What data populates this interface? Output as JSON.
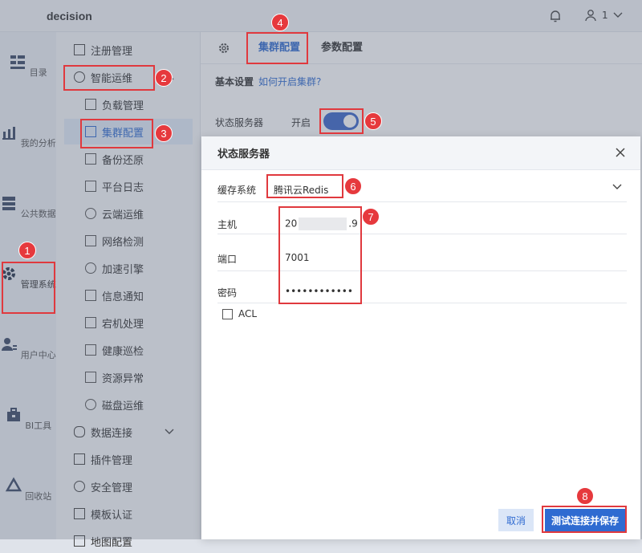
{
  "app": {
    "title": "decision",
    "user_label": "1"
  },
  "leftnav": [
    {
      "label": "目录",
      "icon": "catalog-icon"
    },
    {
      "label": "我的分析",
      "icon": "analysis-icon"
    },
    {
      "label": "公共数据",
      "icon": "database-icon"
    },
    {
      "label": "管理系统",
      "icon": "system-gear-icon"
    },
    {
      "label": "用户中心",
      "icon": "user-center-icon"
    },
    {
      "label": "BI工具",
      "icon": "toolbox-icon"
    },
    {
      "label": "回收站",
      "icon": "recycle-icon"
    }
  ],
  "submenu": {
    "register": "注册管理",
    "smart_ops": "智能运维",
    "children": [
      "负载管理",
      "集群配置",
      "备份还原",
      "平台日志",
      "云端运维",
      "网络检测",
      "加速引擎",
      "信息通知",
      "宕机处理",
      "健康巡检",
      "资源异常",
      "磁盘运维"
    ],
    "data_conn": "数据连接",
    "plugin": "插件管理",
    "security": "安全管理",
    "template": "模板认证",
    "map": "地图配置"
  },
  "main": {
    "tabs": [
      "集群配置",
      "参数配置"
    ],
    "basic": "基本设置",
    "howto_link": "如何开启集群?",
    "server_label": "状态服务器",
    "server_state": "开启"
  },
  "dialog": {
    "title": "状态服务器",
    "cache_label": "缓存系统",
    "cache_value": "腾讯云Redis",
    "host_label": "主机",
    "host_prefix": "20",
    "host_suffix": ".9",
    "port_label": "端口",
    "port_value": "7001",
    "password_label": "密码",
    "password_value": "••••••••••••",
    "acl_label": "ACL",
    "cancel": "取消",
    "save": "测试连接并保存"
  },
  "badges": [
    "1",
    "2",
    "3",
    "4",
    "5",
    "6",
    "7",
    "8"
  ],
  "colors": {
    "accent": "#2f6bd1",
    "annotation": "#e0393e"
  }
}
